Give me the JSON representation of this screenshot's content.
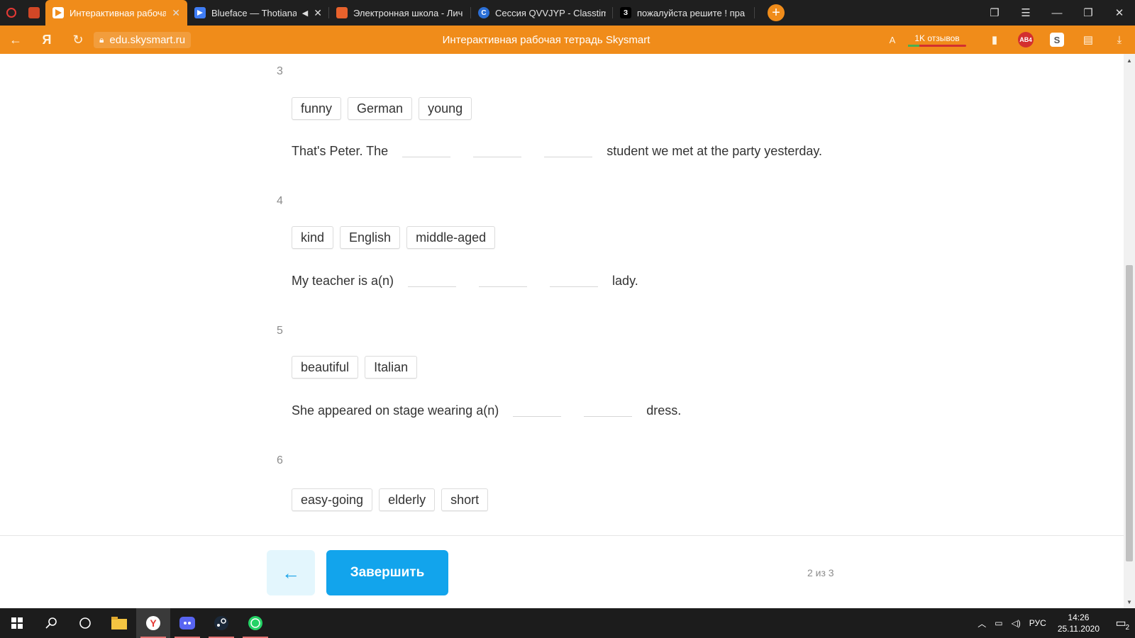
{
  "browser": {
    "tabs": [
      {
        "title": "Интерактивная рабоча",
        "active": true,
        "icon": "skysmart-icon"
      },
      {
        "title": "Blueface — Thotiana",
        "active": false,
        "icon": "play-icon"
      },
      {
        "title": "Электронная школа - Лич",
        "active": false,
        "icon": "school-icon"
      },
      {
        "title": "Сессия QVVJYP - Classtim",
        "active": false,
        "icon": "classtime-icon"
      },
      {
        "title": "пожалуйста решите ! пра",
        "active": false,
        "icon": "znanija-icon"
      }
    ],
    "pinned_icons": [
      "record-icon",
      "powerpoint-icon"
    ],
    "znanija_glyph": "З",
    "url": "edu.skysmart.ru",
    "page_title": "Интерактивная рабочая тетрадь Skysmart",
    "reviews": "1K отзывов",
    "ab_badge": "AB",
    "ab_count": "4",
    "s_badge": "S",
    "accent_color": "#f08c1a"
  },
  "tasks": [
    {
      "number": "3",
      "words": [
        "funny",
        "German",
        "young"
      ],
      "before": "That's Peter. The",
      "after": "student we met at the party yesterday.",
      "blanks": 3
    },
    {
      "number": "4",
      "words": [
        "kind",
        "English",
        "middle-aged"
      ],
      "before": "My teacher is a(n)",
      "after": "lady.",
      "blanks": 3
    },
    {
      "number": "5",
      "words": [
        "beautiful",
        "Italian"
      ],
      "before": "She appeared on stage wearing a(n)",
      "after": "dress.",
      "blanks": 2
    },
    {
      "number": "6",
      "words": [
        "easy-going",
        "elderly",
        "short"
      ],
      "before": "",
      "after": "",
      "blanks": 0
    }
  ],
  "footer": {
    "back_icon": "arrow-left-icon",
    "finish_label": "Завершить",
    "pager": "2 из 3",
    "button_color": "#12a4ec"
  },
  "taskbar": {
    "language": "РУС",
    "time": "14:26",
    "date": "25.11.2020",
    "notifications": "2"
  }
}
